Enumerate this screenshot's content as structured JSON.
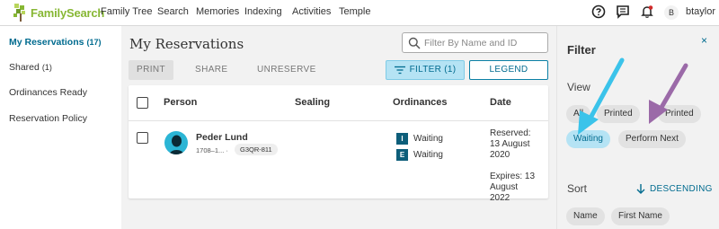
{
  "header": {
    "logo_text": "FamilySearch",
    "nav": [
      "Family Tree",
      "Search",
      "Memories",
      "Indexing",
      "Activities",
      "Temple"
    ],
    "avatar_initial": "B",
    "username": "btaylor"
  },
  "sidebar": {
    "items": [
      {
        "label": "My Reservations",
        "count": "(17)",
        "active": true
      },
      {
        "label": "Shared",
        "count": "(1)",
        "active": false
      },
      {
        "label": "Ordinances Ready",
        "count": "",
        "active": false
      },
      {
        "label": "Reservation Policy",
        "count": "",
        "active": false
      }
    ]
  },
  "main": {
    "title": "My Reservations",
    "search_placeholder": "Filter By Name and ID",
    "toolbar": {
      "print": "PRINT",
      "share": "SHARE",
      "unreserve": "UNRESERVE",
      "filter": "FILTER (1)",
      "legend": "LEGEND"
    },
    "table": {
      "columns": [
        "Person",
        "Sealing",
        "Ordinances",
        "Date"
      ],
      "rows": [
        {
          "name": "Peder Lund",
          "dates": "1708–1...",
          "separator": "·",
          "pid": "G3QR-811",
          "ordinances": [
            {
              "code": "I",
              "status": "Waiting"
            },
            {
              "code": "E",
              "status": "Waiting"
            }
          ],
          "date_lines": [
            "Reserved:",
            "13 August",
            "2020",
            "",
            "Expires: 13",
            "August",
            "2022"
          ]
        }
      ]
    }
  },
  "filter_panel": {
    "title": "Filter",
    "close": "×",
    "view_label": "View",
    "view_chips": [
      "All",
      "Printed",
      "Printed",
      "Waiting",
      "Perform Next"
    ],
    "view_selected": "Waiting",
    "sort_label": "Sort",
    "sort_order": "DESCENDING",
    "sort_chips": [
      "Name",
      "First Name"
    ]
  },
  "colors": {
    "accent": "#006b8f",
    "selected_chip": "#b5e3f4",
    "ordinance_badge": "#0d5e7a",
    "annotation_cyan": "#3bc3ea",
    "annotation_purple": "#9b6aa8"
  }
}
